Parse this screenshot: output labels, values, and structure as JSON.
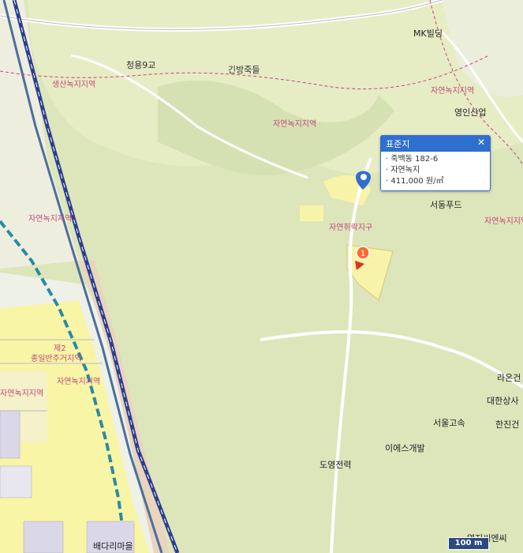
{
  "labels": {
    "bridge": "청용9교",
    "business_1": "긴방죽들",
    "building_mk": "MK빌딩",
    "company_youngin": "영인산업",
    "company_seodong": "서동푸드",
    "company_raon": "라온건",
    "company_daehan": "대한상사",
    "company_hanjin": "한진건",
    "company_seoul": "서울고속",
    "company_ies": "이에스개발",
    "company_doyoung": "도영전력",
    "company_youngji": "영지씨엔씨",
    "village": "배다리마을",
    "zone_production": "생산녹지지역",
    "zone_nature_1": "자연녹지지역",
    "zone_nature_2": "자연녹지지역",
    "zone_nature_3": "자연녹지지역",
    "zone_nature_4": "자연녹지지역",
    "zone_nature_5": "자연녹지지역",
    "zone_nature_6": "자연녹지지역",
    "zone_village": "자연취락지구",
    "zone_res_code": "제2",
    "zone_res": "종일반주거지역"
  },
  "popup": {
    "title": "표준지",
    "lines": [
      "죽백동 182-6",
      "자연녹지",
      "411,000 원/㎡"
    ]
  },
  "marker_number": "1",
  "scale": "100 m",
  "colors": {
    "land": "#e3e8c4",
    "natural_green": "#d3dfb1",
    "residential": "#f8f4a6",
    "railway": "#2c3e8e"
  }
}
